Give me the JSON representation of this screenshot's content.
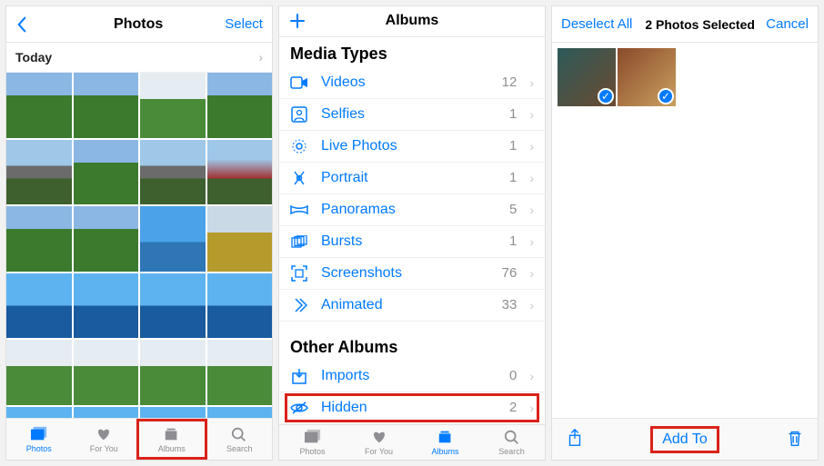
{
  "screen1": {
    "title": "Photos",
    "select_label": "Select",
    "today_label": "Today",
    "tabs": {
      "photos": "Photos",
      "foryou": "For You",
      "albums": "Albums",
      "search": "Search"
    }
  },
  "screen2": {
    "title": "Albums",
    "media_types_title": "Media Types",
    "other_albums_title": "Other Albums",
    "media_types": [
      {
        "icon": "video",
        "label": "Videos",
        "count": "12"
      },
      {
        "icon": "selfie",
        "label": "Selfies",
        "count": "1"
      },
      {
        "icon": "live",
        "label": "Live Photos",
        "count": "1"
      },
      {
        "icon": "portrait",
        "label": "Portrait",
        "count": "1"
      },
      {
        "icon": "pano",
        "label": "Panoramas",
        "count": "5"
      },
      {
        "icon": "burst",
        "label": "Bursts",
        "count": "1"
      },
      {
        "icon": "screenshot",
        "label": "Screenshots",
        "count": "76"
      },
      {
        "icon": "animated",
        "label": "Animated",
        "count": "33"
      }
    ],
    "other_albums": [
      {
        "icon": "import",
        "label": "Imports",
        "count": "0"
      },
      {
        "icon": "hidden",
        "label": "Hidden",
        "count": "2",
        "highlighted": true
      }
    ],
    "tabs": {
      "photos": "Photos",
      "foryou": "For You",
      "albums": "Albums",
      "search": "Search"
    }
  },
  "screen3": {
    "deselect_label": "Deselect All",
    "title": "2 Photos Selected",
    "cancel_label": "Cancel",
    "addto_label": "Add To"
  }
}
